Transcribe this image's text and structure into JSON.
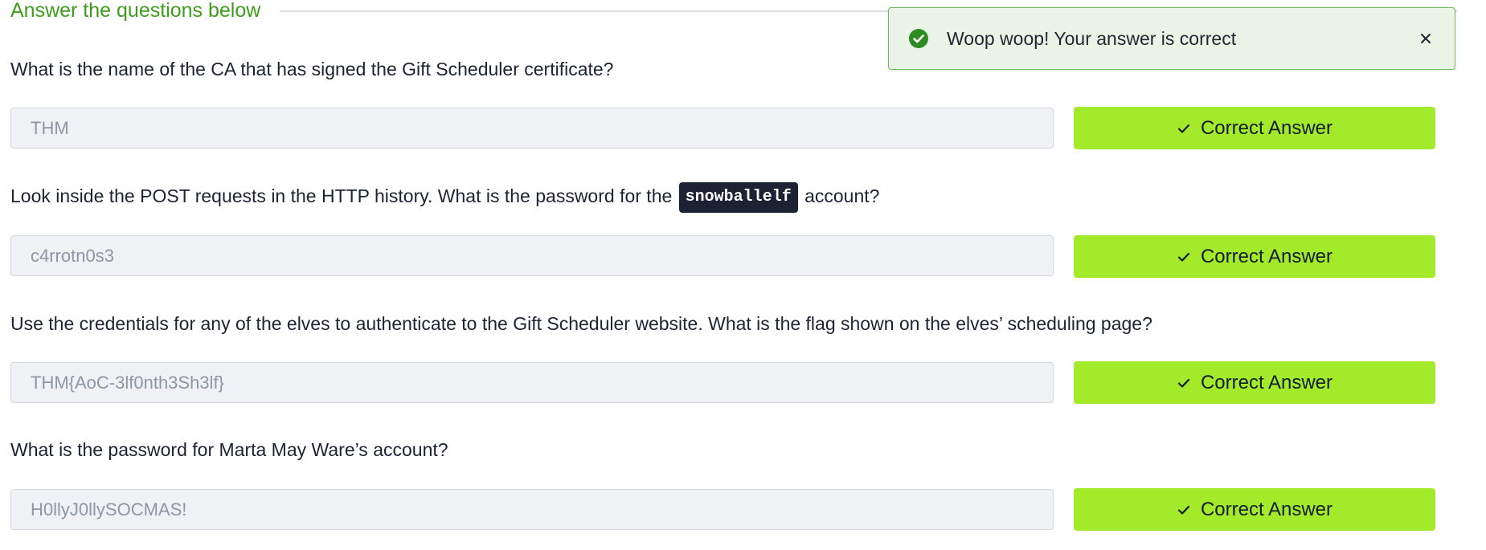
{
  "section": {
    "title": "Answer the questions below"
  },
  "questions": [
    {
      "text": "What is the name of the CA that has signed the Gift Scheduler certificate?",
      "answer": "THM",
      "button_label": "Correct Answer"
    },
    {
      "text_before": "Look inside the POST requests in the HTTP history. What is the password for the",
      "code": "snowballelf",
      "text_after": "account?",
      "answer": "c4rrotn0s3",
      "button_label": "Correct Answer"
    },
    {
      "text": "Use the credentials for any of the elves to authenticate to the Gift Scheduler website. What is the flag shown on the elves’ scheduling page?",
      "answer": "THM{AoC-3lf0nth3Sh3lf}",
      "button_label": "Correct Answer"
    },
    {
      "text": "What is the password for Marta May Ware’s account?",
      "answer": "H0llyJ0llySOCMAS!",
      "button_label": "Correct Answer"
    }
  ],
  "toast": {
    "message": "Woop woop! Your answer is correct",
    "icon": "check-circle-icon",
    "close_icon": "close-icon"
  },
  "colors": {
    "accent_green": "#3e9d1b",
    "button_green": "#a3ea2a",
    "toast_bg": "#e9f4e6",
    "code_bg": "#1a2234"
  }
}
